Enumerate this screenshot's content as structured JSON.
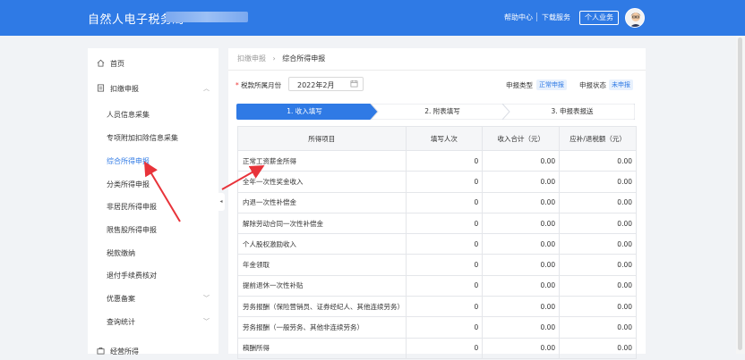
{
  "header": {
    "title": "自然人电子税务局",
    "links": [
      "帮助中心",
      "下载服务"
    ],
    "personal_button": "个人业务",
    "brand_color": "#2f7ae5"
  },
  "sidebar": {
    "top_items": [
      {
        "label": "首页",
        "icon": "home-icon"
      },
      {
        "label": "扣缴申报",
        "icon": "document-icon",
        "expanded": true
      }
    ],
    "sub_items": [
      "人员信息采集",
      "专项附加扣除信息采集",
      "综合所得申报",
      "分类所得申报",
      "非居民所得申报",
      "限售股所得申报",
      "税款缴纳",
      "退付手续费核对",
      "优惠备案",
      "查询统计"
    ],
    "active_sub_item": "综合所得申报",
    "bottom_item": {
      "label": "经营所得",
      "icon": "briefcase-icon"
    }
  },
  "breadcrumb": {
    "parent": "扣缴申报",
    "separator": "›",
    "current": "综合所得申报"
  },
  "filters": {
    "period_label": "税款所属月份",
    "period_value": "2022年2月",
    "report_type_label": "申报类型",
    "report_type_value": "正常申报",
    "report_status_label": "申报状态",
    "report_status_value": "未申报"
  },
  "steps": [
    {
      "label": "1. 收入填写",
      "active": true
    },
    {
      "label": "2. 附表填写",
      "active": false
    },
    {
      "label": "3. 申报表报送",
      "active": false
    }
  ],
  "table": {
    "columns": [
      "所得项目",
      "填写人次",
      "收入合计（元）",
      "应补/退税额（元）"
    ],
    "rows": [
      {
        "item": "正常工资薪金所得",
        "count": "0",
        "income": "0.00",
        "tax": "0.00"
      },
      {
        "item": "全年一次性奖金收入",
        "count": "0",
        "income": "0.00",
        "tax": "0.00"
      },
      {
        "item": "内退一次性补偿金",
        "count": "0",
        "income": "0.00",
        "tax": "0.00"
      },
      {
        "item": "解除劳动合同一次性补偿金",
        "count": "0",
        "income": "0.00",
        "tax": "0.00"
      },
      {
        "item": "个人股权激励收入",
        "count": "0",
        "income": "0.00",
        "tax": "0.00"
      },
      {
        "item": "年金领取",
        "count": "0",
        "income": "0.00",
        "tax": "0.00"
      },
      {
        "item": "提前退休一次性补贴",
        "count": "0",
        "income": "0.00",
        "tax": "0.00"
      },
      {
        "item": "劳务报酬（保险营销员、证券经纪人、其他连续劳务）",
        "count": "0",
        "income": "0.00",
        "tax": "0.00"
      },
      {
        "item": "劳务报酬（一般劳务、其他非连续劳务）",
        "count": "0",
        "income": "0.00",
        "tax": "0.00"
      },
      {
        "item": "稿酬所得",
        "count": "0",
        "income": "0.00",
        "tax": "0.00"
      }
    ]
  },
  "annotation_color": "#e8333a"
}
